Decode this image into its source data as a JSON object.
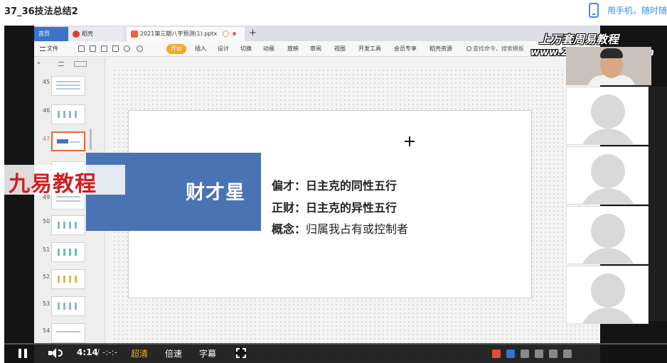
{
  "page": {
    "title": "37_36技法总结2",
    "mobile_link": "用手机，随时随"
  },
  "app": {
    "tabs": {
      "home": "首页",
      "wps": "稻壳",
      "file": "2021第三期八字预测(1).pptx"
    },
    "ribbon": {
      "file_menu": "文件",
      "tabs": [
        "开始",
        "插入",
        "设计",
        "切换",
        "动画",
        "放映",
        "审阅",
        "视图",
        "开发工具",
        "会员专享",
        "稻壳资源"
      ],
      "active_tab": "开始",
      "search_placeholder": "查找命令、搜索模板"
    },
    "thumbnails": {
      "numbers": [
        "45",
        "46",
        "47",
        "49",
        "50",
        "51",
        "52",
        "53",
        "54"
      ],
      "active": "47"
    },
    "slide": {
      "title": "财才星",
      "lines": [
        {
          "term": "偏才：",
          "definition": "日主克的同性五行"
        },
        {
          "term": "正财：",
          "definition": "日主克的异性五行"
        },
        {
          "term": "概念：",
          "definition": "归属我占有或控制者"
        }
      ]
    }
  },
  "watermarks": {
    "left": "九易教程",
    "top_line1": "上万套周易教程",
    "top_line2": "www.265zhouyiw.com"
  },
  "player": {
    "time_current": "4:14",
    "time_separator": "/ -:-:-",
    "quality": "超清",
    "speed": "倍速",
    "subtitles": "字幕"
  },
  "colors": {
    "slide_title_box": "#4a73b3",
    "active_ribbon_tab": "#f5a623",
    "watermark_red": "#d21f1f",
    "link_blue": "#3a8ee6"
  }
}
